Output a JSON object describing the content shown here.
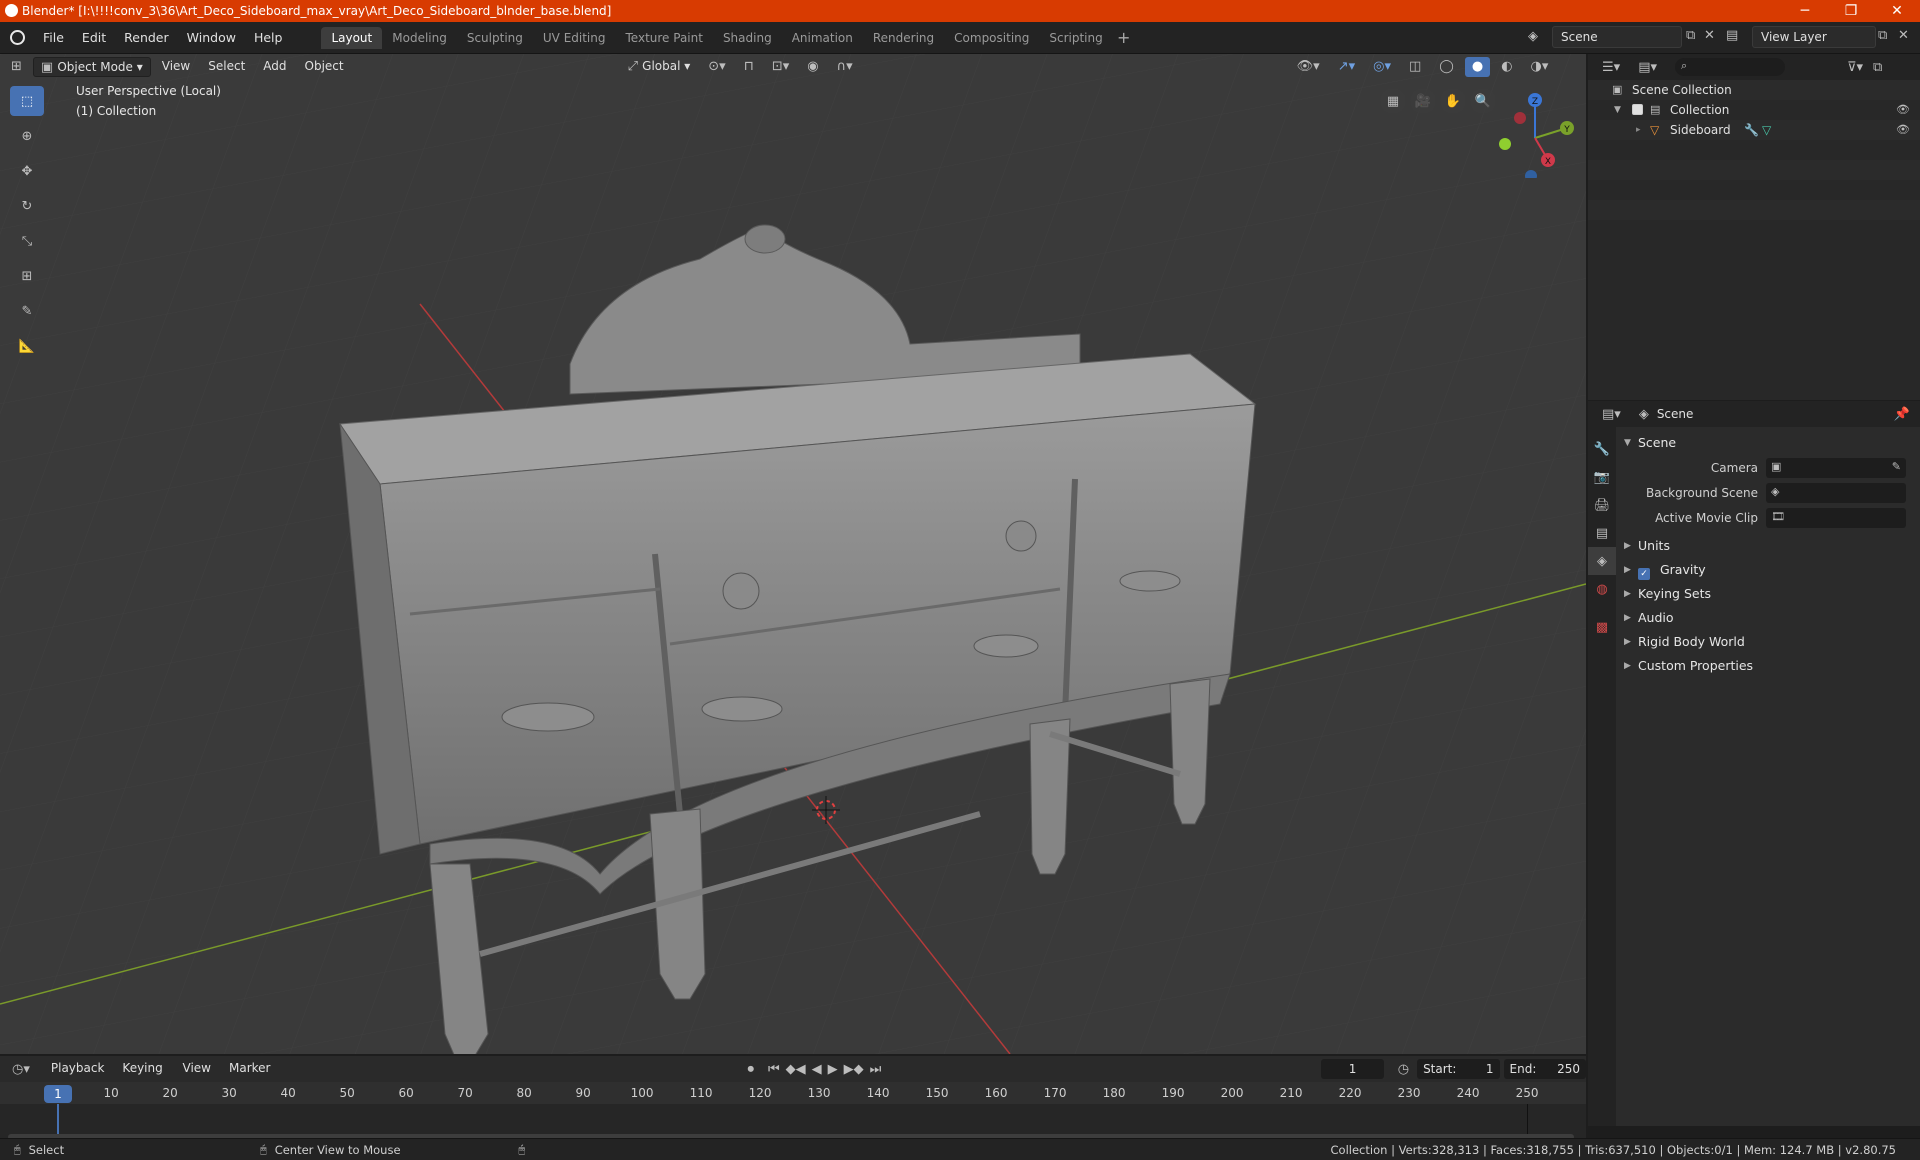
{
  "window": {
    "title": "Blender* [I:\\!!!!conv_3\\36\\Art_Deco_Sideboard_max_vray\\Art_Deco_Sideboard_blnder_base.blend]",
    "minimize": "─",
    "maximize": "❐",
    "close": "✕"
  },
  "menu": {
    "items": [
      "File",
      "Edit",
      "Render",
      "Window",
      "Help"
    ]
  },
  "workspaces": {
    "tabs": [
      "Layout",
      "Modeling",
      "Sculpting",
      "UV Editing",
      "Texture Paint",
      "Shading",
      "Animation",
      "Rendering",
      "Compositing",
      "Scripting"
    ],
    "active": "Layout",
    "add": "+"
  },
  "scene_selector": {
    "value": "Scene"
  },
  "view_layer_selector": {
    "value": "View Layer"
  },
  "viewport": {
    "mode": "Object Mode",
    "menus": [
      "View",
      "Select",
      "Add",
      "Object"
    ],
    "orientation": "Global",
    "perspective_label": "User Perspective (Local)",
    "collection_label": "(1) Collection",
    "gizmo": {
      "x": "X",
      "y": "Y",
      "z": "Z"
    }
  },
  "outliner": {
    "search_placeholder": "",
    "rows": [
      {
        "label": "Scene Collection",
        "icon": "scene-collection-icon"
      },
      {
        "label": "Collection",
        "icon": "collection-icon"
      },
      {
        "label": "Sideboard",
        "icon": "mesh-object-icon"
      }
    ]
  },
  "properties": {
    "header": "Scene",
    "scene_panel": "Scene",
    "fields": [
      {
        "label": "Camera",
        "value": ""
      },
      {
        "label": "Background Scene",
        "value": ""
      },
      {
        "label": "Active Movie Clip",
        "value": ""
      }
    ],
    "panels": [
      {
        "label": "Units"
      },
      {
        "label": "Gravity",
        "checkbox": true
      },
      {
        "label": "Keying Sets"
      },
      {
        "label": "Audio"
      },
      {
        "label": "Rigid Body World"
      },
      {
        "label": "Custom Properties"
      }
    ]
  },
  "timeline": {
    "menus": [
      "Playback",
      "Keying",
      "View",
      "Marker"
    ],
    "current_frame": "1",
    "start_label": "Start:",
    "start": "1",
    "end_label": "End:",
    "end": "250",
    "ruler": [
      "10",
      "20",
      "30",
      "40",
      "50",
      "60",
      "70",
      "80",
      "90",
      "100",
      "110",
      "120",
      "130",
      "140",
      "150",
      "160",
      "170",
      "180",
      "190",
      "200",
      "210",
      "220",
      "230",
      "240",
      "250"
    ],
    "playhead": "1"
  },
  "statusbar": {
    "left": "Select",
    "middle": "Center View to Mouse",
    "right": "Collection | Verts:328,313 | Faces:318,755 | Tris:637,510 | Objects:0/1 | Mem: 124.7 MB | v2.80.75"
  },
  "colors": {
    "accent": "#4772b3",
    "titlebar": "#d83b01",
    "grid_x_axis": "#b33a3a",
    "grid_y_axis": "#7a9a2a"
  }
}
